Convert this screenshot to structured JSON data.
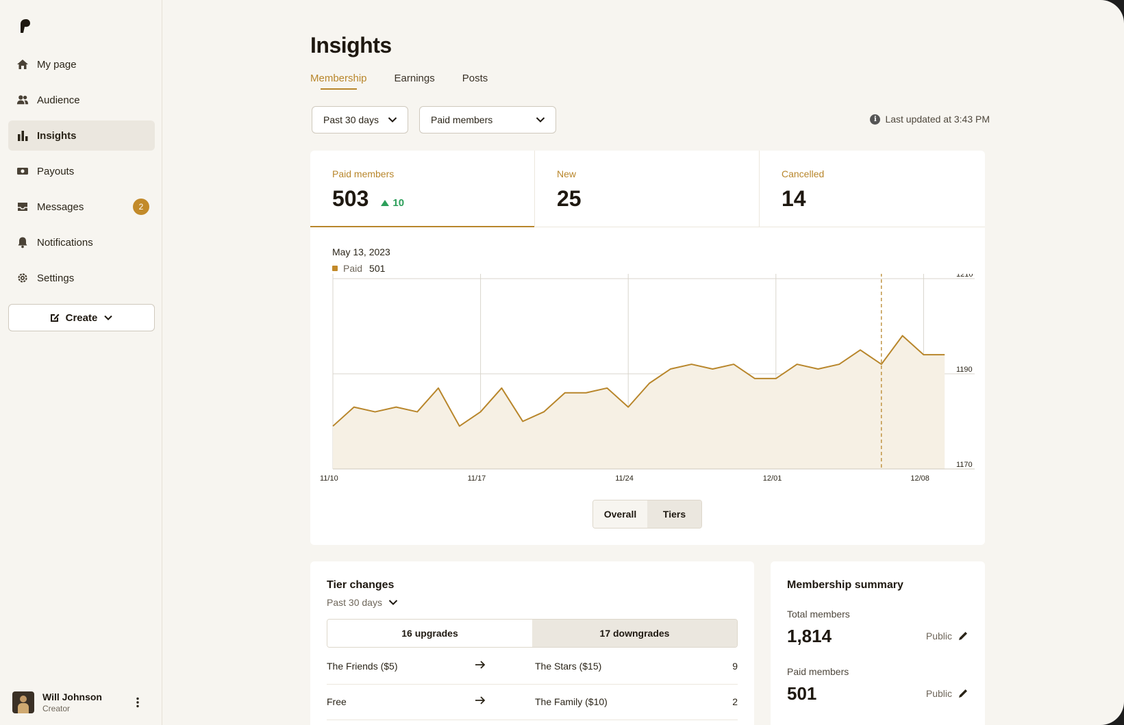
{
  "sidebar": {
    "items": [
      {
        "label": "My page",
        "icon": "home-icon"
      },
      {
        "label": "Audience",
        "icon": "people-icon"
      },
      {
        "label": "Insights",
        "icon": "bar-chart-icon",
        "active": true
      },
      {
        "label": "Payouts",
        "icon": "money-icon"
      },
      {
        "label": "Messages",
        "icon": "inbox-icon",
        "badge": "2"
      },
      {
        "label": "Notifications",
        "icon": "bell-icon"
      },
      {
        "label": "Settings",
        "icon": "gear-icon"
      }
    ],
    "create_label": "Create",
    "user": {
      "name": "Will Johnson",
      "role": "Creator"
    }
  },
  "page": {
    "title": "Insights",
    "tabs": [
      "Membership",
      "Earnings",
      "Posts"
    ],
    "filters": {
      "period": "Past 30 days",
      "segment": "Paid members"
    },
    "last_updated": "Last updated at 3:43 PM"
  },
  "stats": [
    {
      "label": "Paid members",
      "value": "503",
      "delta": "10"
    },
    {
      "label": "New",
      "value": "25"
    },
    {
      "label": "Cancelled",
      "value": "14"
    }
  ],
  "tooltip": {
    "date": "May 13, 2023",
    "series": "Paid",
    "value": "501"
  },
  "chart_data": {
    "type": "area",
    "x_tick_labels": [
      "11/10",
      "11/17",
      "11/24",
      "12/01",
      "12/08"
    ],
    "y_tick_labels": [
      "1210",
      "1190",
      "1170"
    ],
    "ylim": [
      1170,
      1211
    ],
    "series": [
      {
        "name": "Paid",
        "values": [
          1179,
          1183,
          1182,
          1183,
          1182,
          1187,
          1179,
          1182,
          1187,
          1180,
          1182,
          1186,
          1186,
          1187,
          1183,
          1188,
          1191,
          1192,
          1191,
          1192,
          1189,
          1189,
          1192,
          1191,
          1192,
          1195,
          1192,
          1198,
          1194,
          1194
        ]
      }
    ],
    "highlight_index": 26,
    "accent": "#b8862b",
    "fill": "#f6f0e4",
    "grid": true
  },
  "chart_toggle": {
    "overall": "Overall",
    "tiers": "Tiers"
  },
  "tier_changes": {
    "title": "Tier changes",
    "period": "Past 30 days",
    "upgrades": "16 upgrades",
    "downgrades": "17 downgrades",
    "rows": [
      {
        "from": "The Friends ($5)",
        "to": "The Stars ($15)",
        "count": "9"
      },
      {
        "from": "Free",
        "to": "The Family ($10)",
        "count": "2"
      }
    ]
  },
  "membership_summary": {
    "title": "Membership summary",
    "items": [
      {
        "label": "Total members",
        "value": "1,814",
        "visibility": "Public"
      },
      {
        "label": "Paid members",
        "value": "501",
        "visibility": "Public"
      }
    ]
  }
}
